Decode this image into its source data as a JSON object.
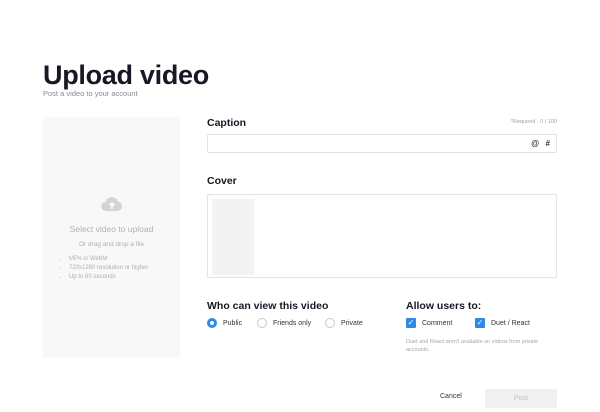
{
  "header": {
    "title": "Upload video",
    "subtitle": "Post a video to your account"
  },
  "upload": {
    "icon": "cloud-upload-icon",
    "title": "Select video to upload",
    "drag": "Or drag and drop a file",
    "requirements": [
      "MP4 or WebM",
      "720x1280 resolution or higher",
      "Up to 60 seconds"
    ]
  },
  "caption": {
    "label": "Caption",
    "count": "*Required · 0 / 100",
    "value": "",
    "at_icon": "@",
    "hash_icon": "#"
  },
  "cover": {
    "label": "Cover"
  },
  "visibility": {
    "label": "Who can view this video",
    "options": [
      "Public",
      "Friends only",
      "Private"
    ],
    "selected": "Public"
  },
  "allow": {
    "label": "Allow users to:",
    "options": [
      {
        "label": "Comment",
        "checked": true
      },
      {
        "label": "Duet / React",
        "checked": true
      }
    ],
    "note": "Duet and React aren't available on videos from private accounts."
  },
  "actions": {
    "cancel": "Cancel",
    "post": "Post"
  },
  "colors": {
    "accent": "#2e8ae6"
  }
}
